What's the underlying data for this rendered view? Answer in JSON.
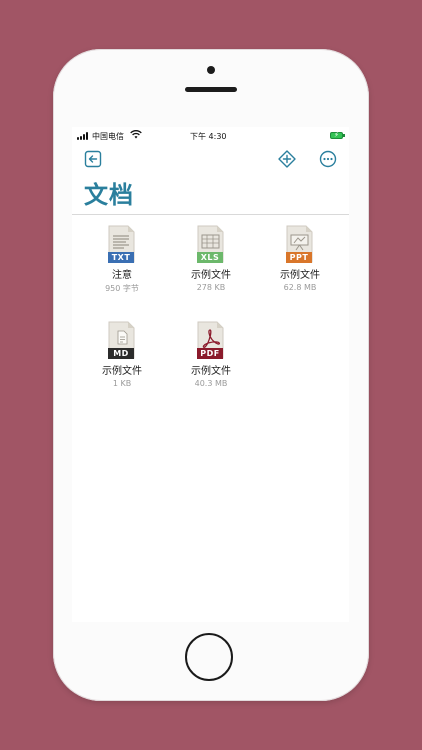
{
  "status": {
    "carrier": "中国电信",
    "time": "下午 4:30"
  },
  "page": {
    "title": "文档"
  },
  "files": [
    {
      "name": "注意",
      "size": "950 字节",
      "type_label": "TXT",
      "icon": "txt-file-icon",
      "color": "#3a6fb3"
    },
    {
      "name": "示例文件",
      "size": "278 KB",
      "type_label": "XLS",
      "icon": "xls-file-icon",
      "color": "#6cb86b"
    },
    {
      "name": "示例文件",
      "size": "62.8 MB",
      "type_label": "PPT",
      "icon": "ppt-file-icon",
      "color": "#d9762a"
    },
    {
      "name": "示例文件",
      "size": "1 KB",
      "type_label": "MD",
      "icon": "md-file-icon",
      "color": "#2b2b2b"
    },
    {
      "name": "示例文件",
      "size": "40.3 MB",
      "type_label": "PDF",
      "icon": "pdf-file-icon",
      "color": "#8b1a2b"
    }
  ],
  "colors": {
    "background": "#a15565",
    "accent": "#2a7f9d"
  }
}
